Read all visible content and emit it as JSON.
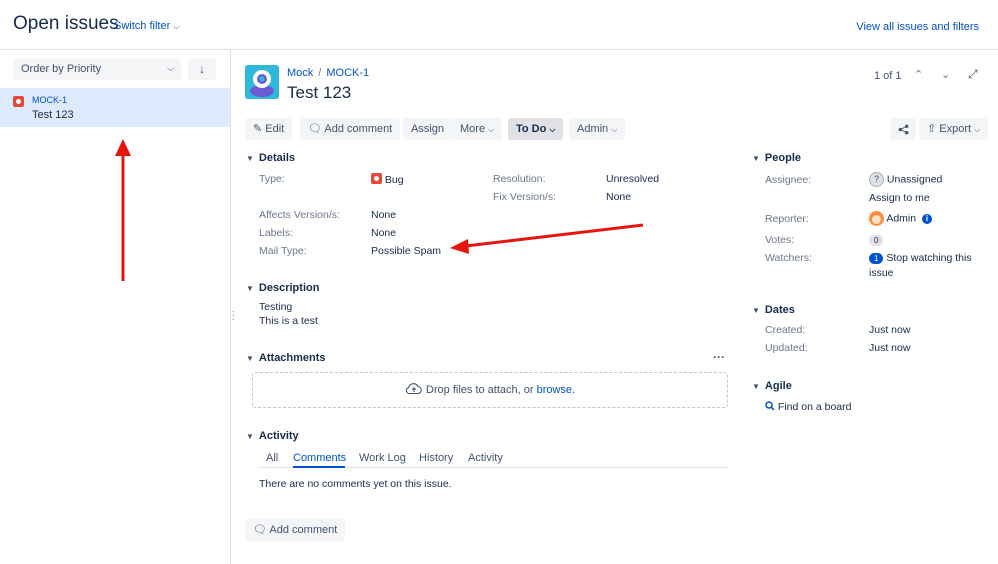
{
  "header": {
    "title": "Open issues",
    "switch_filter": "Switch filter",
    "view_all": "View all issues and filters"
  },
  "left": {
    "order_by": "Order by Priority",
    "items": [
      {
        "key": "MOCK-1",
        "summary": "Test 123"
      }
    ]
  },
  "issue": {
    "project": "Mock",
    "key": "MOCK-1",
    "title": "Test 123",
    "pager": "1 of 1"
  },
  "toolbar": {
    "edit": "Edit",
    "add_comment": "Add comment",
    "assign": "Assign",
    "more": "More",
    "status": "To Do",
    "admin": "Admin",
    "export": "Export"
  },
  "details": {
    "heading": "Details",
    "type_label": "Type:",
    "type_value": "Bug",
    "resolution_label": "Resolution:",
    "resolution_value": "Unresolved",
    "fix_label": "Fix Version/s:",
    "fix_value": "None",
    "affects_label": "Affects Version/s:",
    "affects_value": "None",
    "labels_label": "Labels:",
    "labels_value": "None",
    "mail_label": "Mail Type:",
    "mail_value": "Possible Spam"
  },
  "description": {
    "heading": "Description",
    "line1": "Testing",
    "line2": "This is a test"
  },
  "attachments": {
    "heading": "Attachments",
    "drop_text": "Drop files to attach, or",
    "browse": "browse."
  },
  "activity": {
    "heading": "Activity",
    "tabs": [
      "All",
      "Comments",
      "Work Log",
      "History",
      "Activity"
    ],
    "empty": "There are no comments yet on this issue.",
    "add_comment": "Add comment"
  },
  "people": {
    "heading": "People",
    "assignee_label": "Assignee:",
    "assignee_value": "Unassigned",
    "assign_to_me": "Assign to me",
    "reporter_label": "Reporter:",
    "reporter_value": "Admin",
    "votes_label": "Votes:",
    "votes_value": "0",
    "watchers_label": "Watchers:",
    "watchers_count": "1",
    "watch_line1": "Stop watching this",
    "watch_line2": "issue"
  },
  "dates": {
    "heading": "Dates",
    "created_label": "Created:",
    "created_value": "Just now",
    "updated_label": "Updated:",
    "updated_value": "Just now"
  },
  "agile": {
    "heading": "Agile",
    "find_board": "Find on a board"
  },
  "colors": {
    "link": "#0052cc",
    "bug": "#e5493a",
    "selected_row": "#deebff",
    "annotation_arrow": "#e8140f"
  }
}
